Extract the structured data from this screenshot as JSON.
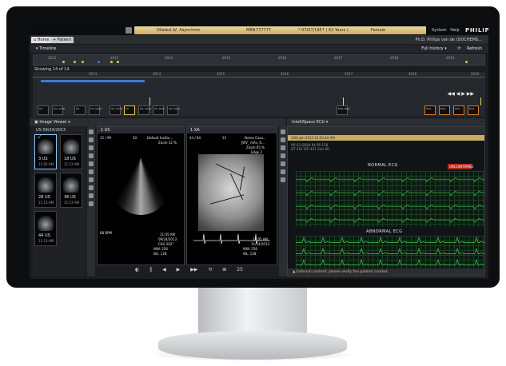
{
  "patient_bar": {
    "diagnosis": "Dilated LV, Asynchron",
    "mrn_label": "MRN",
    "mrn": "777777",
    "dob": "* 07/07/1957 ( 62 Years )",
    "sex": "Female",
    "menu_system": "System",
    "menu_help": "Help",
    "brand": "PHILIPS"
  },
  "tabs": {
    "home": "Home",
    "patient": "Patient",
    "user": "Ph.D. Philips van de (DOCHEMS..."
  },
  "timeline": {
    "title": "Timeline",
    "full_history": "Full history",
    "refresh": "Refresh",
    "showing": "Showing 14 of 14",
    "overview_years": [
      "2012",
      "2013",
      "2014",
      "2015",
      "2016",
      "2017",
      "2018",
      "2019"
    ],
    "detail_years": [
      "2013",
      "2014",
      "2015",
      "2016",
      "2017",
      "2018",
      "2019"
    ],
    "thumbs": [
      {
        "label": "US"
      },
      {
        "label": "US, Adult"
      },
      {
        "label": "US"
      },
      {
        "label": "US, Adult"
      },
      {
        "label": "US, Adult"
      },
      {
        "label": "XA"
      },
      {
        "label": "US, Adult"
      },
      {
        "label": "US, Pedi"
      },
      {
        "label": "US, Adult"
      },
      {
        "label": "ECG, EKG"
      },
      {
        "label": "ECG"
      },
      {
        "label": "ECG"
      },
      {
        "label": "ECG"
      },
      {
        "label": "ECG"
      }
    ],
    "play_controls": "◀◀ ◀ ▶ ▶▶"
  },
  "image_viewer": {
    "title": "Image Viewer",
    "date": "US 09/24/2013",
    "series": [
      {
        "label": "3 US",
        "time": "11:05 AM"
      },
      {
        "label": "18 US",
        "time": "11:13 AM"
      },
      {
        "label": "28 US",
        "time": "11:13 AM"
      },
      {
        "label": "36 US",
        "time": "11:13 AM"
      },
      {
        "label": "44 US",
        "time": "11:13 AM"
      }
    ]
  },
  "viewport_us": {
    "header": "1 US",
    "frame": "15 / 99",
    "fps": "50",
    "institution": "Default Institu...",
    "zoom": "Zoom 32 %",
    "bpm": "68 BPM",
    "ww": "WW: 256",
    "wl": "WL: 128",
    "time": "11:05 AM",
    "date": "09/24/2013",
    "angle": "CAU 262°"
  },
  "viewport_xa": {
    "header": "1 XA",
    "frame": "44 / 84",
    "fps": "15",
    "institution": "Demo Casu...",
    "model": "JWV_ mAs, 6...",
    "zoom": "Zoom 65 %",
    "edge": "Edge 2",
    "ww": "WW: 256",
    "wl": "WL: 128",
    "time": "11:05 AM",
    "date": "11/14/2013"
  },
  "viewer_controls": [
    "◐",
    "‖",
    "◀",
    "▶",
    "▶▶",
    "⟲",
    "⊞",
    "25"
  ],
  "ecg": {
    "title": "IntelliSpace ECG",
    "sub_bar": "13th Jan 2013 12:03:44 AM",
    "meta_1": "HR  63     QRSd  94    PR  158",
    "meta_2": "QT  412    QTc  421    Axis  60",
    "normal_label": "NORMAL ECG",
    "abnormal_label": "ABNORMAL ECG",
    "unconfirmed": "UNCONFIRMED",
    "warning": "External content: please verify the patient context."
  },
  "colors": {
    "accent_yellow": "#c9ae62",
    "ecg_trace": "#35d14a",
    "unconfirmed_red": "#b3251d",
    "timeline_blue": "#3d79d6"
  }
}
